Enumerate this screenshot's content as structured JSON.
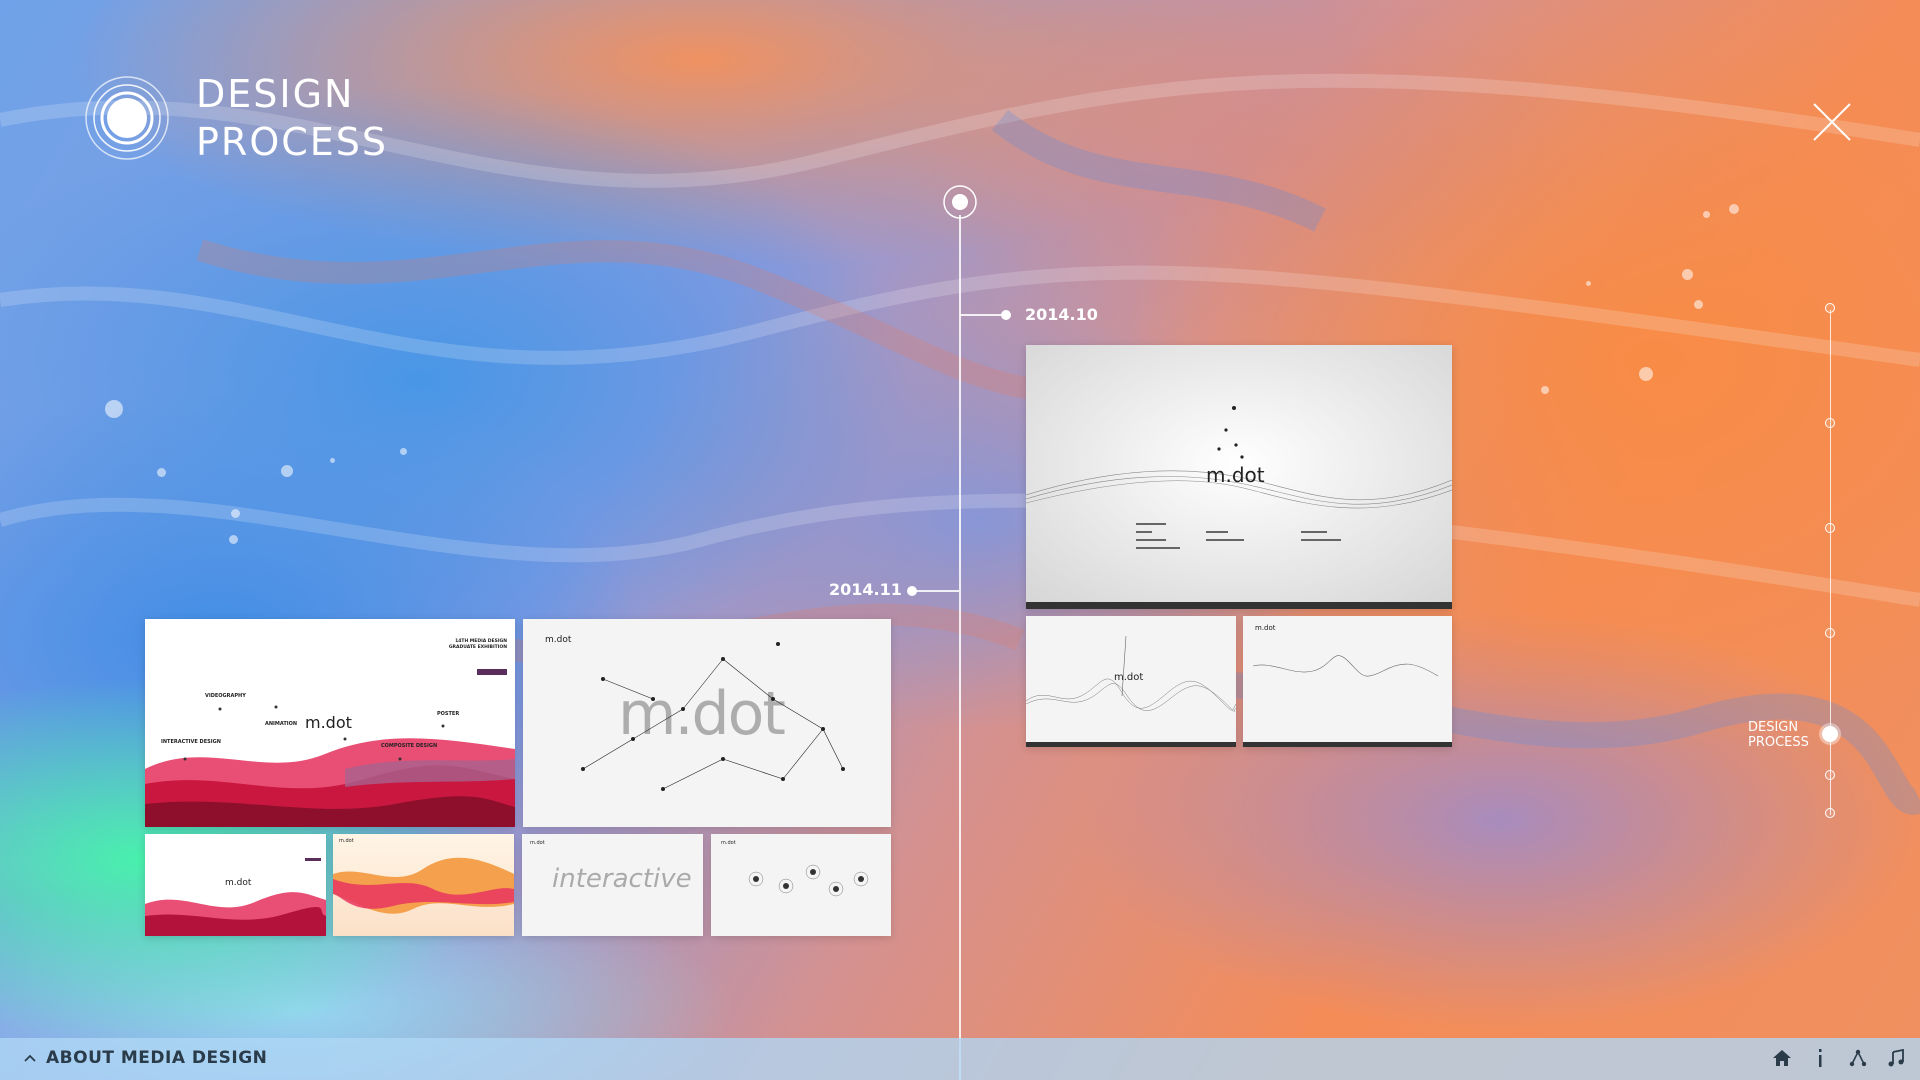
{
  "header": {
    "title_line1": "DESIGN",
    "title_line2": "PROCESS"
  },
  "timeline": {
    "entries": [
      {
        "date": "2014.10"
      },
      {
        "date": "2014.11"
      }
    ]
  },
  "thumbnails": {
    "left_main_1": {
      "logo": "m.dot",
      "labels": [
        "VIDEOGRAPHY",
        "ANIMATION",
        "POSTER",
        "INTERACTIVE DESIGN",
        "COMPOSITE DESIGN"
      ],
      "heading": "14TH MEDIA DESIGN GRADUATE EXHIBITION"
    },
    "left_main_2": {
      "corner": "m.dot",
      "logo": "m.dot"
    },
    "left_small_1": {
      "logo": "m.dot"
    },
    "left_small_2": {
      "corner": "m.dot"
    },
    "left_small_3": {
      "corner": "m.dot",
      "word": "interactive"
    },
    "left_small_4": {
      "corner": "m.dot"
    },
    "right_main": {
      "logo": "m.dot"
    },
    "right_small_1": {
      "logo": "m.dot"
    },
    "right_small_2": {
      "corner": "m.dot"
    }
  },
  "side_nav": {
    "active_label_line1": "DESIGN",
    "active_label_line2": "PROCESS"
  },
  "footer": {
    "left_label": "ABOUT MEDIA DESIGN",
    "icons": [
      "home-icon",
      "info-icon",
      "share-icon",
      "music-icon"
    ]
  },
  "colors": {
    "accent_orange": "#f48c58",
    "accent_blue": "#4c8fe0",
    "accent_green": "#46f5aa",
    "footer_bg": "#afd7f5",
    "footer_text": "#2a3b4a",
    "thumb_pink": "#d8244e"
  }
}
